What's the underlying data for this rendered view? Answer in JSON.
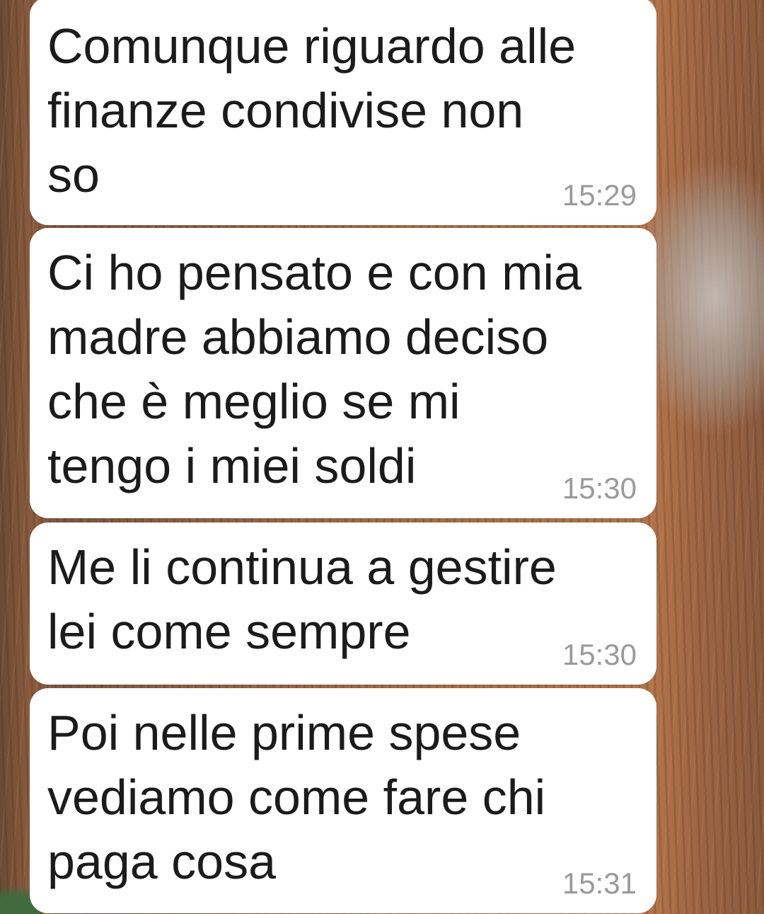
{
  "messages": [
    {
      "text": "Comunque riguardo alle\nfinanze condivise non\nso",
      "time": "15:29"
    },
    {
      "text": "Ci ho pensato e con mia\nmadre abbiamo deciso\nche è meglio se mi\ntengo i miei soldi",
      "time": "15:30"
    },
    {
      "text": "Me li continua a gestire\nlei come sempre",
      "time": "15:30"
    },
    {
      "text": "Poi nelle prime spese\nvediamo come fare chi\npaga cosa",
      "time": "15:31"
    }
  ],
  "colors": {
    "bubble": "#ffffff",
    "text": "#1b1b1b",
    "timestamp": "#9a9a9a"
  }
}
